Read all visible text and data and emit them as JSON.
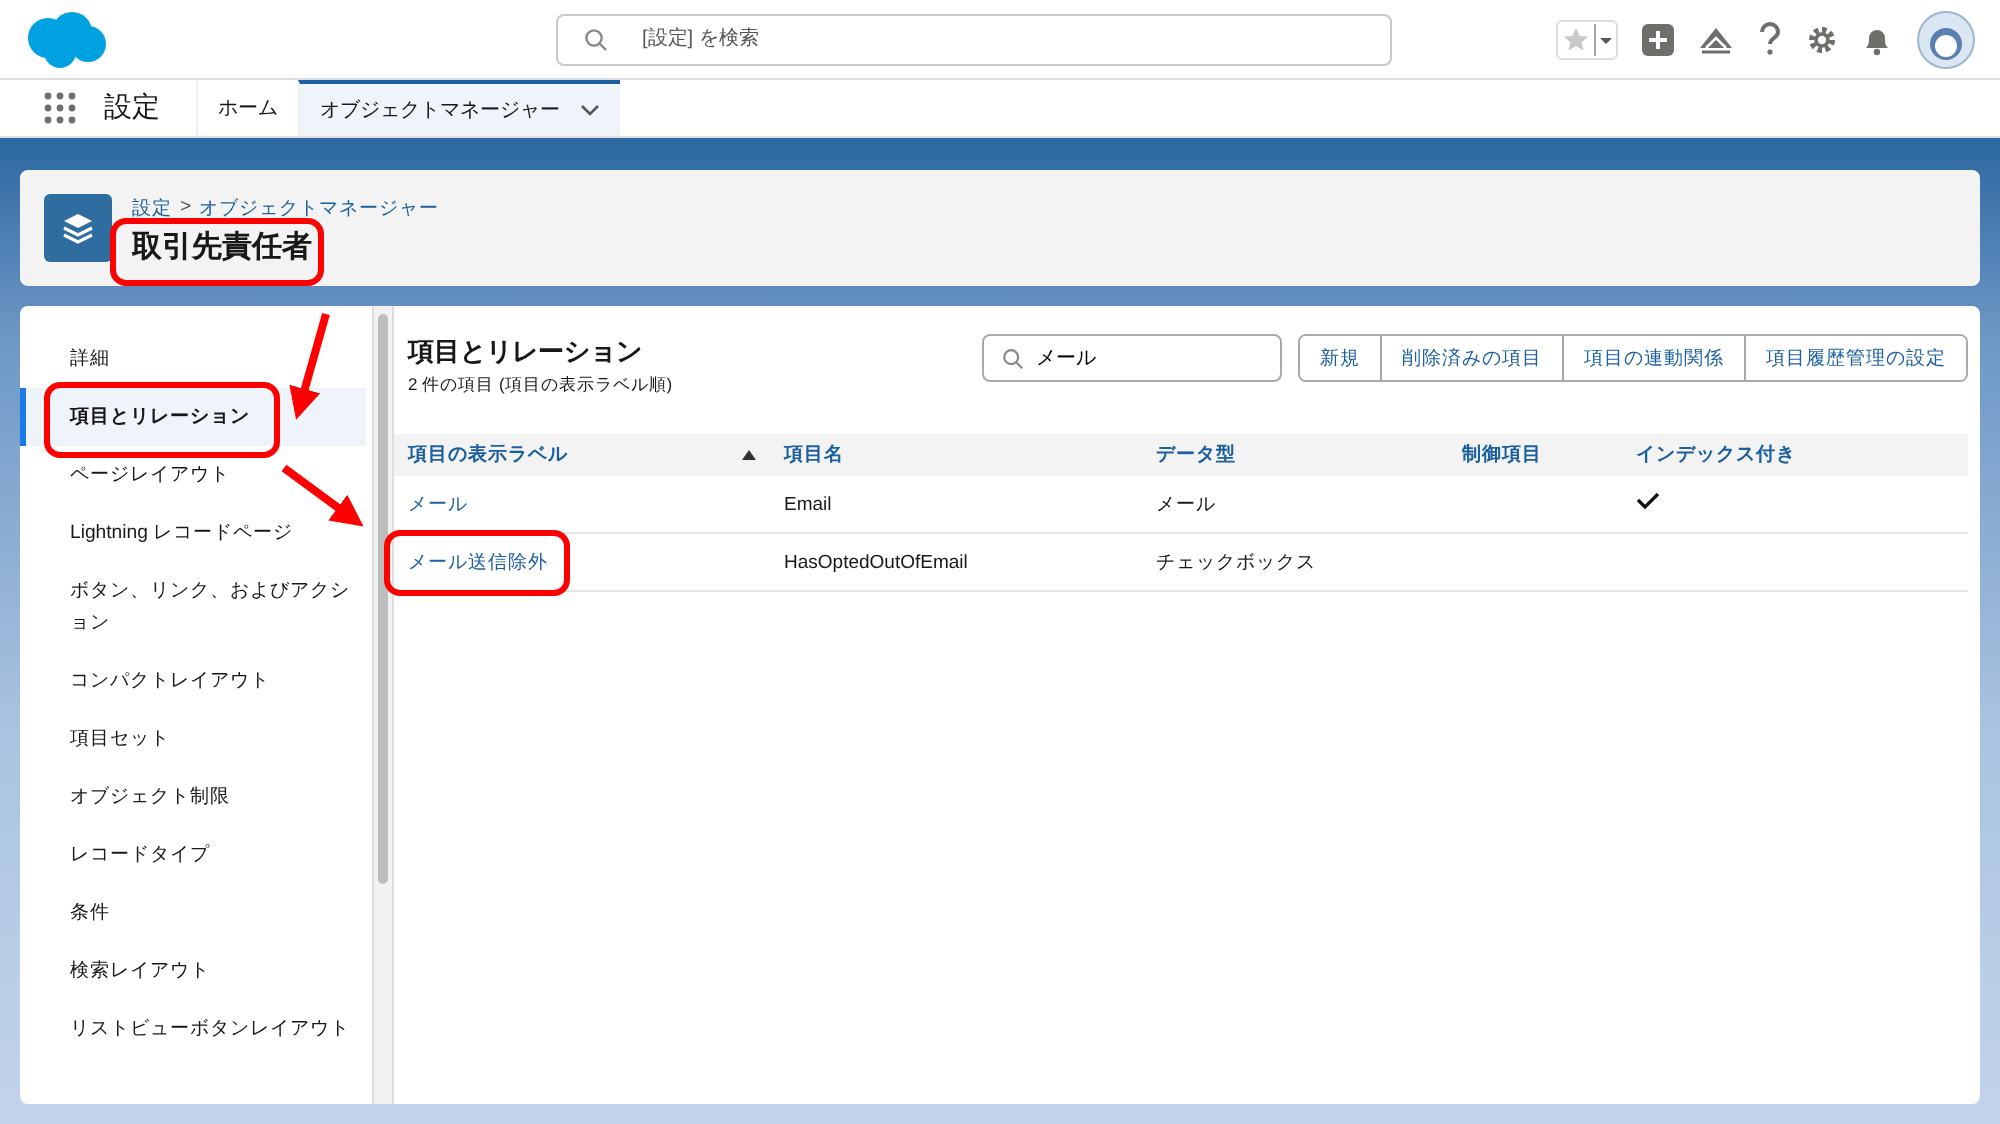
{
  "search": {
    "placeholder": "[設定] を検索"
  },
  "app_name": "設定",
  "nav_tabs": [
    {
      "label": "ホーム",
      "selected": false,
      "dropdown": false
    },
    {
      "label": "オブジェクトマネージャー",
      "selected": true,
      "dropdown": true
    }
  ],
  "breadcrumb": [
    {
      "label": "設定"
    },
    {
      "label": "オブジェクトマネージャー"
    }
  ],
  "breadcrumb_separator": ">",
  "object_title": {
    "label": "取引先責任者",
    "highlighted": true
  },
  "sidebar": {
    "items": [
      {
        "label": "詳細",
        "selected": false,
        "highlighted": false
      },
      {
        "label": "項目とリレーション",
        "selected": true,
        "highlighted": true
      },
      {
        "label": "ページレイアウト",
        "selected": false,
        "highlighted": false
      },
      {
        "label": "Lightning レコードページ",
        "selected": false,
        "highlighted": false
      },
      {
        "label": "ボタン、リンク、およびアクション",
        "selected": false,
        "highlighted": false
      },
      {
        "label": "コンパクトレイアウト",
        "selected": false,
        "highlighted": false
      },
      {
        "label": "項目セット",
        "selected": false,
        "highlighted": false
      },
      {
        "label": "オブジェクト制限",
        "selected": false,
        "highlighted": false
      },
      {
        "label": "レコードタイプ",
        "selected": false,
        "highlighted": false
      },
      {
        "label": "条件",
        "selected": false,
        "highlighted": false
      },
      {
        "label": "検索レイアウト",
        "selected": false,
        "highlighted": false
      },
      {
        "label": "リストビューボタンレイアウト",
        "selected": false,
        "highlighted": false
      }
    ]
  },
  "section": {
    "title": "項目とリレーション",
    "subtitle": "2 件の項目 (項目の表示ラベル順)"
  },
  "filter": {
    "value": "メール"
  },
  "buttons": [
    "新規",
    "削除済みの項目",
    "項目の連動関係",
    "項目履歴管理の設定"
  ],
  "table": {
    "columns": [
      {
        "label": "項目の表示ラベル",
        "sorted": true
      },
      {
        "label": "項目名",
        "sorted": false
      },
      {
        "label": "データ型",
        "sorted": false
      },
      {
        "label": "制御項目",
        "sorted": false
      },
      {
        "label": "インデックス付き",
        "sorted": false
      }
    ],
    "rows": [
      {
        "label": "メール",
        "name": "Email",
        "type": "メール",
        "indexed": true,
        "highlighted": false
      },
      {
        "label": "メール送信除外",
        "name": "HasOptedOutOfEmail",
        "type": "チェックボックス",
        "indexed": false,
        "highlighted": true
      }
    ]
  }
}
